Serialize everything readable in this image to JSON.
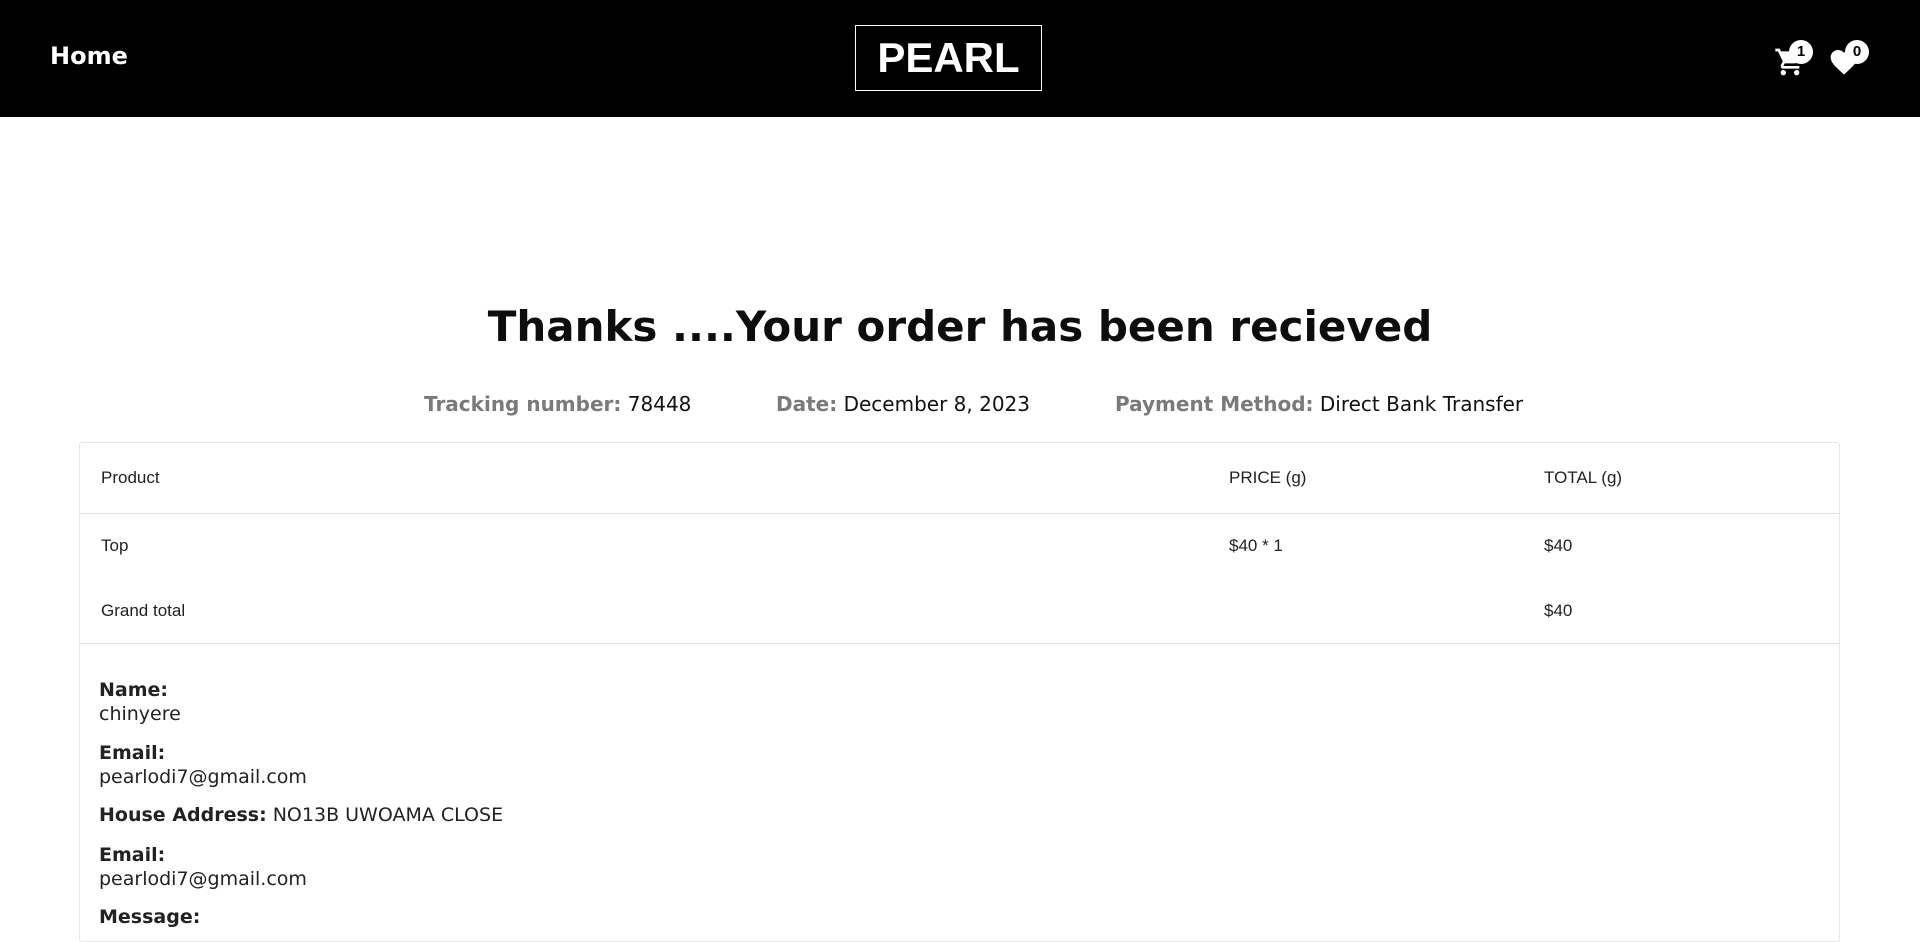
{
  "header": {
    "home_label": "Home",
    "logo_text": "PEARL",
    "cart_count": "1",
    "wishlist_count": "0"
  },
  "confirmation": {
    "title": "Thanks ....Your order has been recieved",
    "tracking_label": "Tracking number:",
    "tracking_value": "78448",
    "date_label": "Date:",
    "date_value": "December 8, 2023",
    "payment_label": "Payment Method:",
    "payment_value": "Direct Bank Transfer"
  },
  "order_table": {
    "headers": [
      "Product",
      "PRICE (g)",
      "TOTAL (g)"
    ],
    "rows": [
      {
        "product": "Top",
        "price": "$40 * 1",
        "total": "$40"
      }
    ],
    "grand_total_label": "Grand total",
    "grand_total_value": "$40"
  },
  "customer": {
    "name_label": "Name:",
    "name_value": "chinyere",
    "email_label": "Email:",
    "email_value": "pearlodi7@gmail.com",
    "address_label": "House Address:",
    "address_value": "NO13B UWOAMA CLOSE",
    "email2_label": "Email:",
    "email2_value": "pearlodi7@gmail.com",
    "message_label": "Message:"
  },
  "icons": [
    "cart-icon",
    "heart-icon"
  ]
}
